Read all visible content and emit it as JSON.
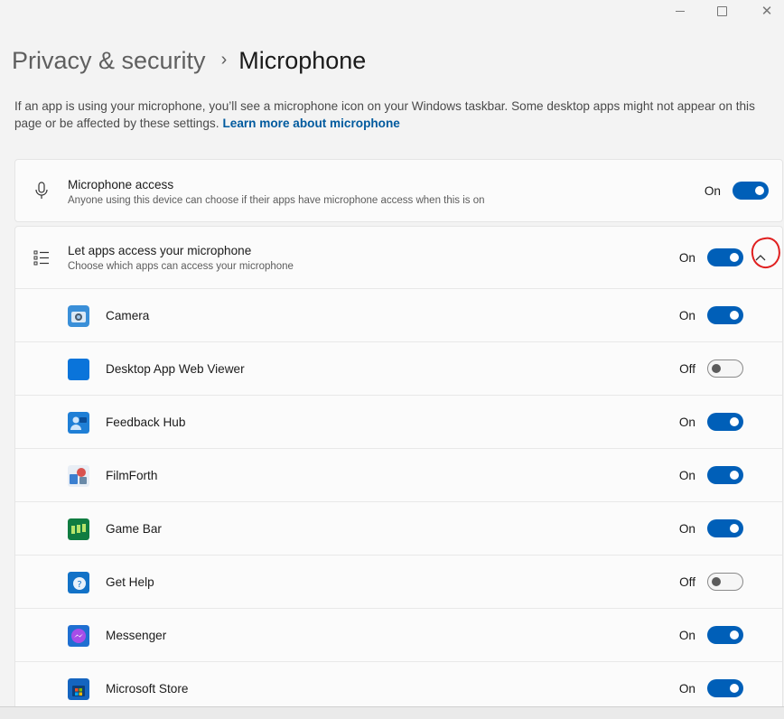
{
  "window": {
    "close_glyph": "✕"
  },
  "breadcrumb": {
    "parent": "Privacy & security",
    "separator": "›",
    "current": "Microphone"
  },
  "description": {
    "text": "If an app is using your microphone, you’ll see a microphone icon on your Windows taskbar. Some desktop apps might not appear on this page or be affected by these settings.",
    "link": "Learn more about microphone"
  },
  "microphone_access": {
    "title": "Microphone access",
    "subtitle": "Anyone using this device can choose if their apps have microphone access when this is on",
    "state": "On",
    "icon": "microphone-icon"
  },
  "let_apps": {
    "title": "Let apps access your microphone",
    "subtitle": "Choose which apps can access your microphone",
    "state": "On",
    "icon": "list-icon"
  },
  "apps": [
    {
      "name": "Camera",
      "state": "On",
      "icon": "camera-app-icon",
      "color": "#2b8ad8"
    },
    {
      "name": "Desktop App Web Viewer",
      "state": "Off",
      "icon": "desktop-app-web-viewer-icon",
      "color": "#0a74da"
    },
    {
      "name": "Feedback Hub",
      "state": "On",
      "icon": "feedback-hub-icon",
      "color": "#1f7fd6"
    },
    {
      "name": "FilmForth",
      "state": "On",
      "icon": "filmforth-icon",
      "color": "#c44c3b"
    },
    {
      "name": "Game Bar",
      "state": "On",
      "icon": "game-bar-icon",
      "color": "#0f7c47"
    },
    {
      "name": "Get Help",
      "state": "Off",
      "icon": "get-help-icon",
      "color": "#1272c7"
    },
    {
      "name": "Messenger",
      "state": "On",
      "icon": "messenger-icon",
      "color": "#8a3fe0"
    },
    {
      "name": "Microsoft Store",
      "state": "On",
      "icon": "microsoft-store-icon",
      "color": "#1565c0"
    }
  ],
  "colors": {
    "accent": "#005fb8",
    "annotation": "#e02020"
  }
}
